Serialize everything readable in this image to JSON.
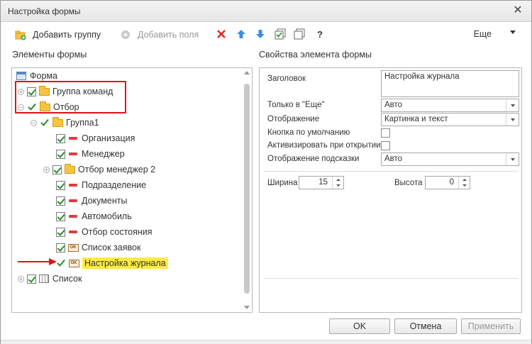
{
  "window": {
    "title": "Настройка формы"
  },
  "toolbar": {
    "add_group": "Добавить группу",
    "add_fields": "Добавить поля",
    "help": "?",
    "more": "Еще"
  },
  "left": {
    "header": "Элементы формы"
  },
  "right": {
    "header": "Свойства элемента формы"
  },
  "tree": {
    "root": "Форма",
    "command_group": "Группа команд",
    "filter": "Отбор",
    "group1": "Группа1",
    "items": [
      "Организация",
      "Менеджер",
      "Отбор менеджер 2",
      "Подразделение",
      "Документы",
      "Автомобиль",
      "Отбор состояния",
      "Список заявок",
      "Настройка журнала"
    ],
    "list": "Список"
  },
  "props": {
    "caption_label": "Заголовок",
    "caption_value": "Настройка журнала",
    "only_more_label": "Только в \"Еще\"",
    "only_more_value": "Авто",
    "display_label": "Отображение",
    "display_value": "Картинка и текст",
    "default_button_label": "Кнопка по умолчанию",
    "activate_label": "Активизировать при открытии",
    "tooltip_label": "Отображение подсказки",
    "tooltip_value": "Авто",
    "width_label": "Ширина",
    "width_value": "15",
    "height_label": "Высота",
    "height_value": "0"
  },
  "buttons": {
    "ok": "OK",
    "cancel": "Отмена",
    "apply": "Применить"
  },
  "colors": {
    "highlight": "#ffe84d",
    "annotation": "#e0131b",
    "check": "#2a8c2a"
  }
}
